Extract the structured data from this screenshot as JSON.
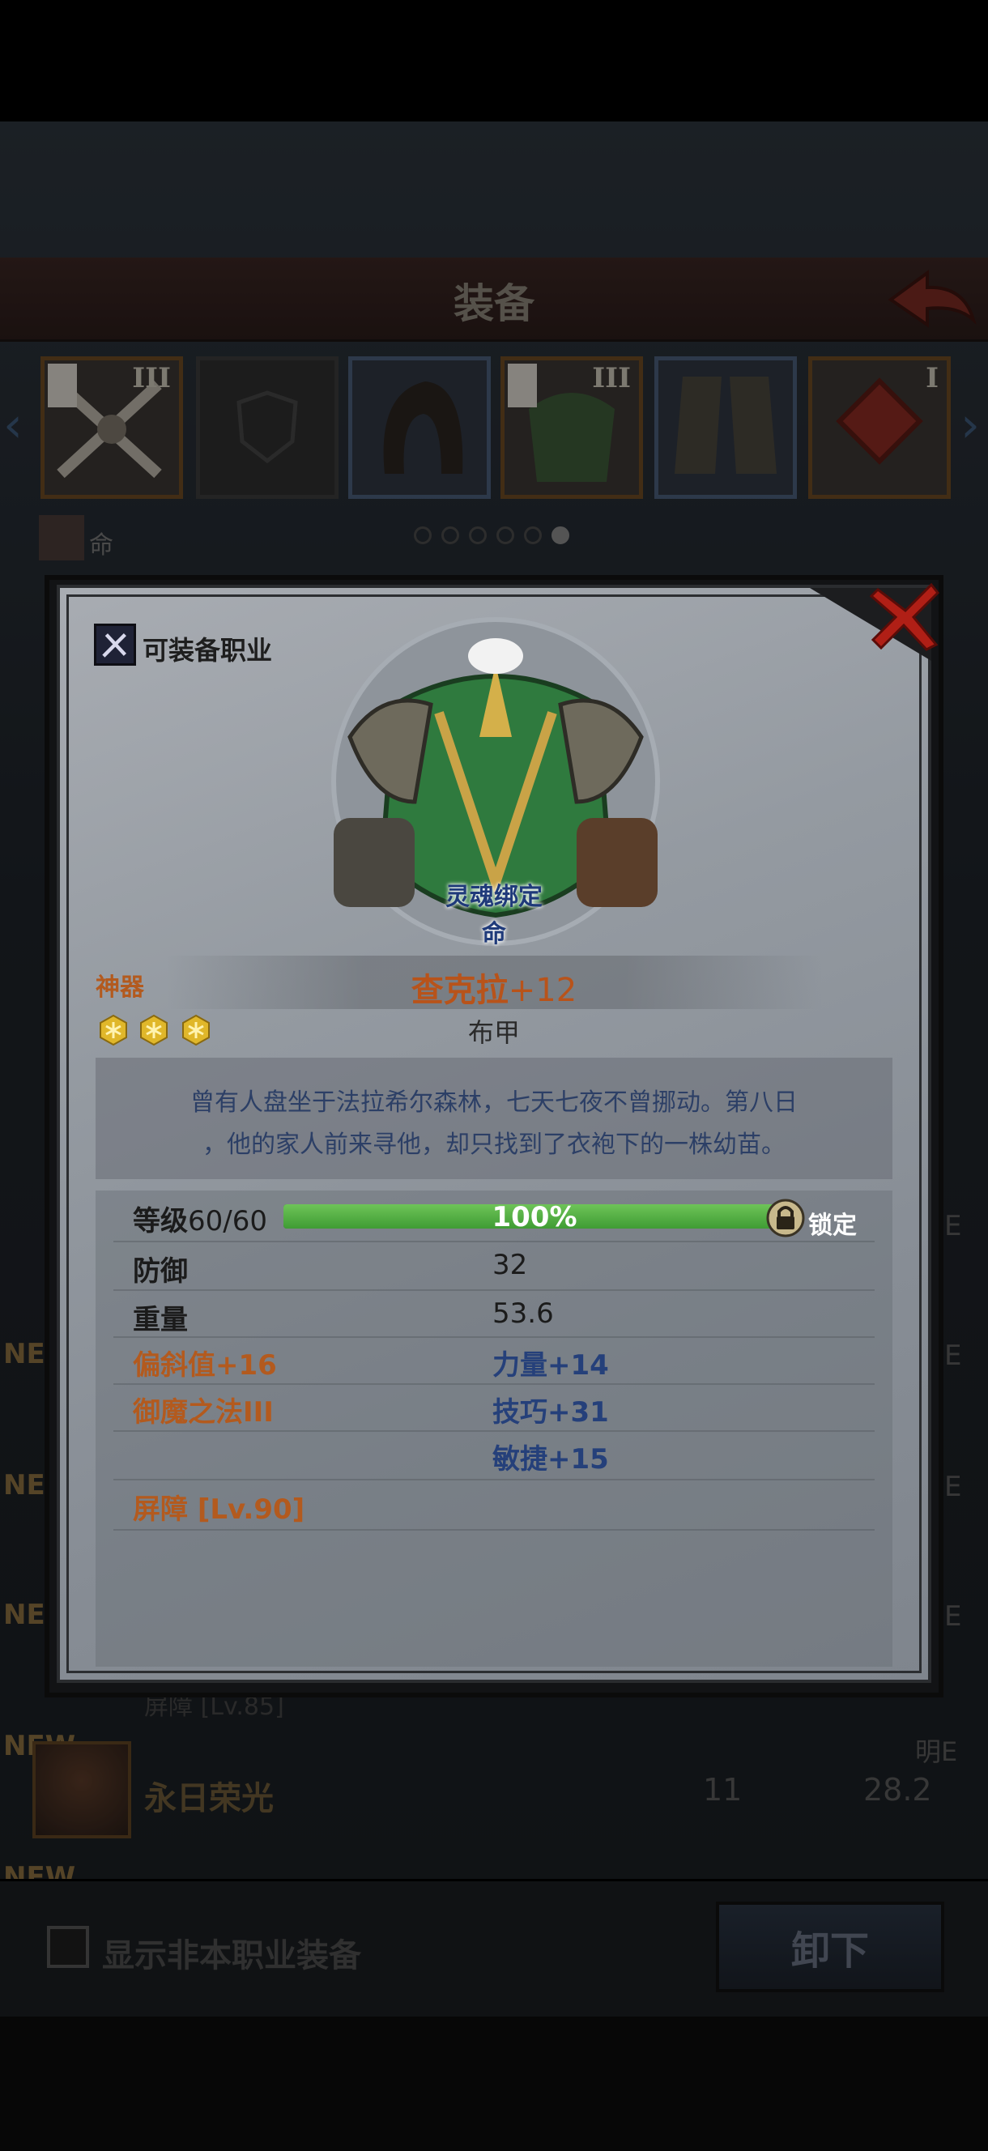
{
  "background": {
    "title": "装备",
    "slots": [
      {
        "tier": "III",
        "style": "gold"
      },
      {
        "tier": "",
        "style": "empty"
      },
      {
        "tier": "",
        "style": "blue"
      },
      {
        "tier": "III",
        "style": "gold"
      },
      {
        "tier": "",
        "style": "blue"
      },
      {
        "tier": "I",
        "style": "gold"
      }
    ],
    "page_dots": 6,
    "active_dot": 5,
    "current_item_label": "命",
    "new_tag": "NEW",
    "right_letter": "E",
    "list_row": {
      "name": "永日荣光",
      "value1": "11",
      "value2": "28.2",
      "header": "明E",
      "sub": "屏障 [Lv.85]"
    },
    "show_non_class_label": "显示非本职业装备",
    "unequip_label": "卸下"
  },
  "dialog": {
    "class_label": "可装备职业",
    "soulbound": "灵魂绑定",
    "soulbound_sub": "命",
    "rarity": "神器",
    "stars": 3,
    "item_name": "查克拉",
    "enhance": "+12",
    "item_type": "布甲",
    "description_line1": "曾有人盘坐于法拉希尔森林，七天七夜不曾挪动。第八日",
    "description_line2": "，他的家人前来寻他，却只找到了衣袍下的一株幼苗。",
    "level_label": "等级",
    "level_value": "60/60",
    "xp_fraction": 1.0,
    "xp_percent": "100%",
    "lock_label": "锁定",
    "stats": {
      "defense_label": "防御",
      "defense_value": "32",
      "weight_label": "重量",
      "weight_value": "53.6",
      "bias_label": "偏斜值+16",
      "strength_label": "力量+14",
      "magic_label": "御魔之法III",
      "skill_label": "技巧+31",
      "agility_label": "敏捷+15",
      "barrier_label": "屏障 [Lv.90]"
    }
  },
  "colors": {
    "rarity": "#b35a1e",
    "bonus": "#25407a",
    "xp_bar": "#4fae3f"
  }
}
